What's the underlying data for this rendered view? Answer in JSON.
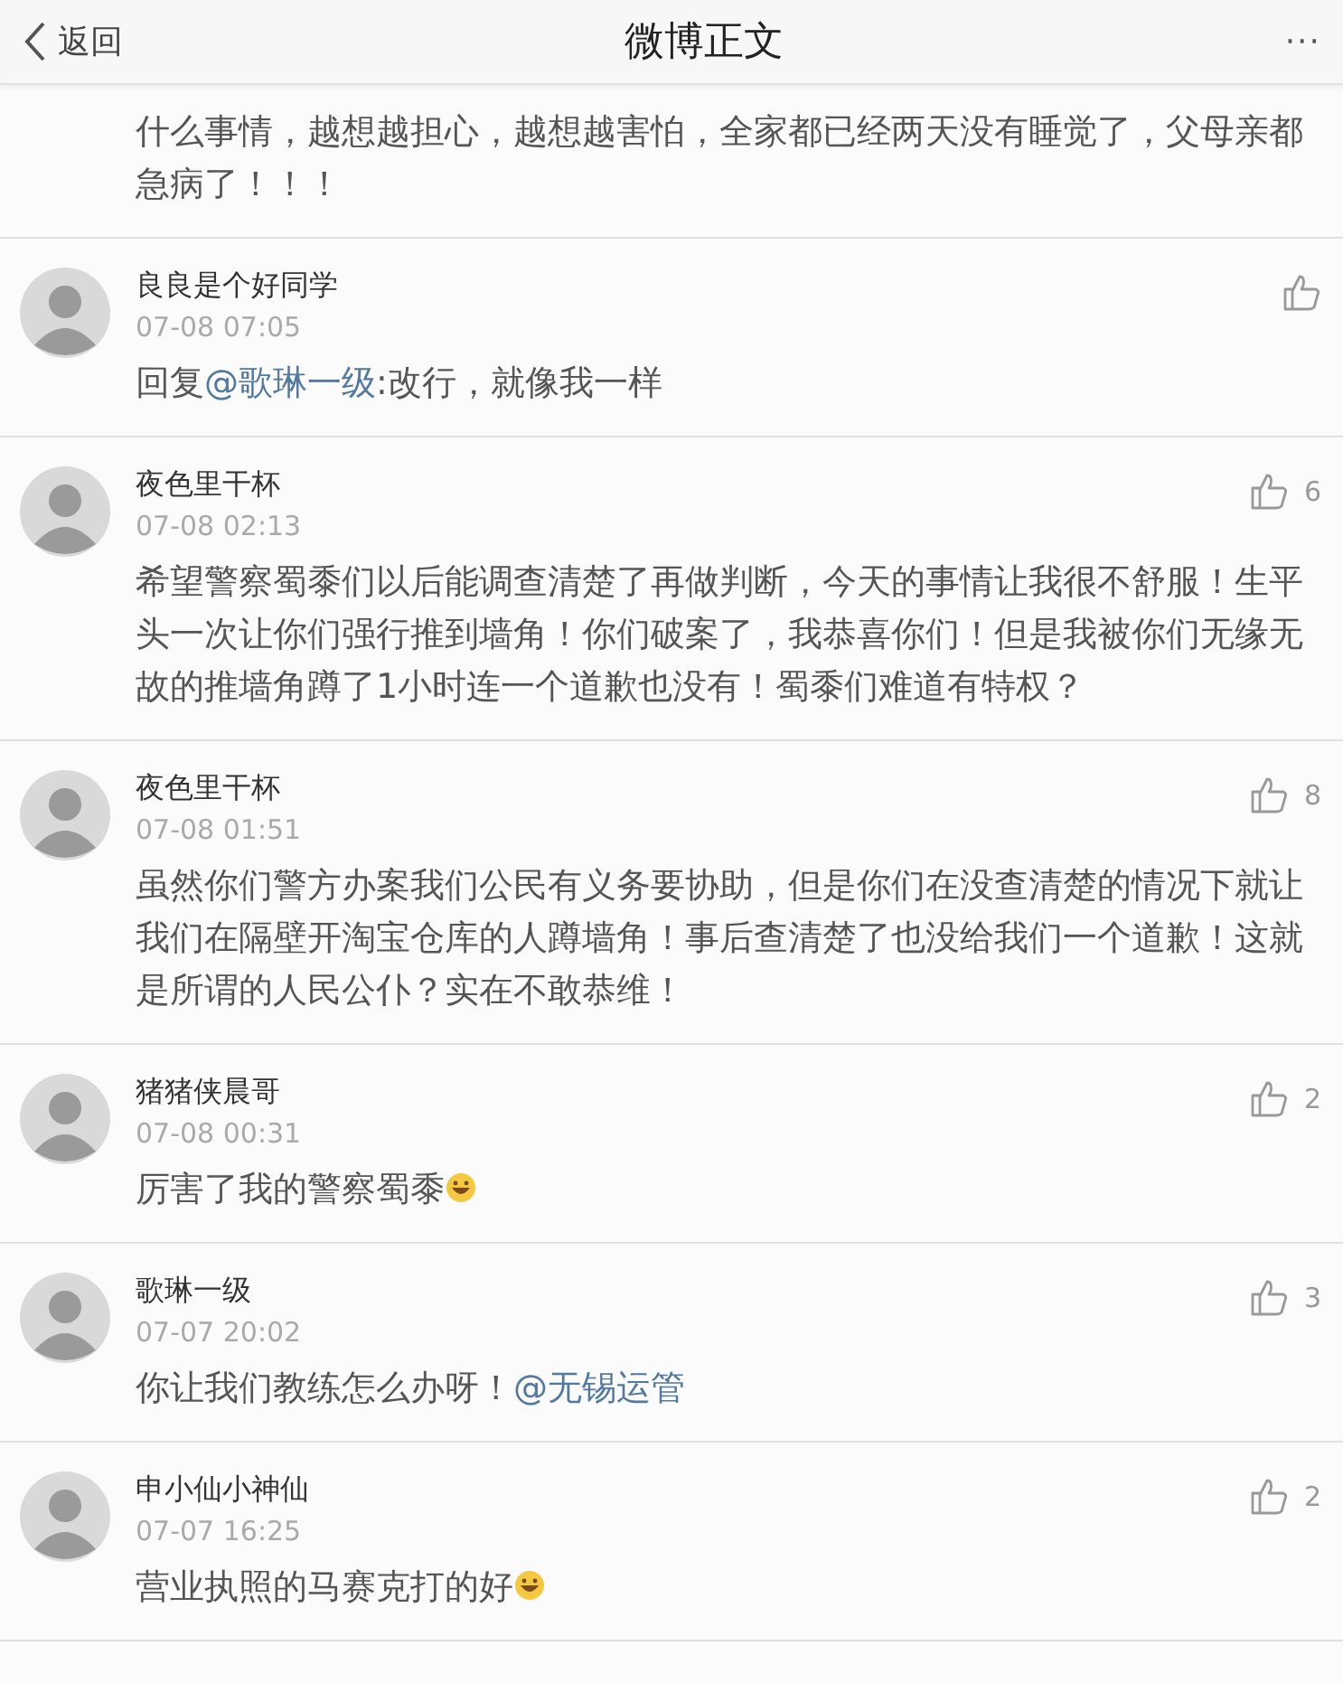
{
  "header": {
    "back": "返回",
    "title": "微博正文",
    "more": "···"
  },
  "partial_comment": {
    "text": "什么事情，越想越担心，越想越害怕，全家都已经两天没有睡觉了，父母亲都急病了！！！"
  },
  "comments": [
    {
      "name": "良良是个好同学",
      "time": "07-08 07:05",
      "body": [
        {
          "kind": "text",
          "text": "回复"
        },
        {
          "kind": "mention",
          "text": "@歌琳一级"
        },
        {
          "kind": "text",
          "text": ":改行，就像我一样"
        }
      ]
    },
    {
      "name": "夜色里干杯",
      "time": "07-08 02:13",
      "likes": "6",
      "body": [
        {
          "kind": "text",
          "text": "希望警察蜀黍们以后能调查清楚了再做判断，今天的事情让我很不舒服！生平头一次让你们强行推到墙角！你们破案了，我恭喜你们！但是我被你们无缘无故的推墙角蹲了1小时连一个道歉也没有！蜀黍们难道有特权？"
        }
      ]
    },
    {
      "name": "夜色里干杯",
      "time": "07-08 01:51",
      "likes": "8",
      "body": [
        {
          "kind": "text",
          "text": "虽然你们警方办案我们公民有义务要协助，但是你们在没查清楚的情况下就让我们在隔壁开淘宝仓库的人蹲墙角！事后查清楚了也没给我们一个道歉！这就是所谓的人民公仆？实在不敢恭维！"
        }
      ]
    },
    {
      "name": "猪猪侠晨哥",
      "time": "07-08 00:31",
      "likes": "2",
      "body": [
        {
          "kind": "text",
          "text": "厉害了我的警察蜀黍"
        },
        {
          "kind": "emoji"
        }
      ]
    },
    {
      "name": "歌琳一级",
      "time": "07-07 20:02",
      "likes": "3",
      "body": [
        {
          "kind": "text",
          "text": "你让我们教练怎么办呀！"
        },
        {
          "kind": "mention",
          "text": "@无锡运管"
        }
      ]
    },
    {
      "name": "申小仙小神仙",
      "time": "07-07 16:25",
      "likes": "2",
      "body": [
        {
          "kind": "text",
          "text": "营业执照的马赛克打的好"
        },
        {
          "kind": "emoji"
        }
      ]
    }
  ]
}
